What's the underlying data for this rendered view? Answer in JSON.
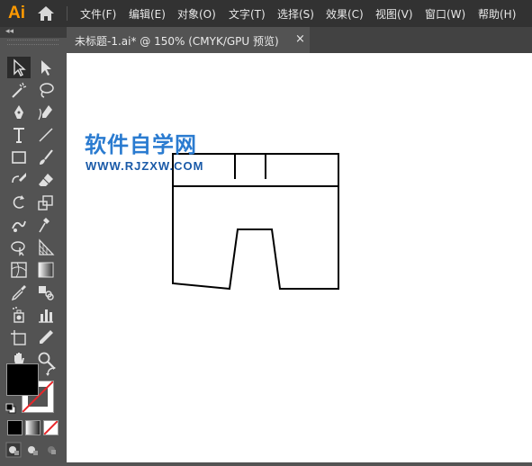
{
  "app": {
    "logo": "Ai"
  },
  "menu": [
    {
      "id": "file",
      "label": "文件(F)"
    },
    {
      "id": "edit",
      "label": "编辑(E)"
    },
    {
      "id": "object",
      "label": "对象(O)"
    },
    {
      "id": "type",
      "label": "文字(T)"
    },
    {
      "id": "select",
      "label": "选择(S)"
    },
    {
      "id": "effect",
      "label": "效果(C)"
    },
    {
      "id": "view",
      "label": "视图(V)"
    },
    {
      "id": "window",
      "label": "窗口(W)"
    },
    {
      "id": "help",
      "label": "帮助(H)"
    }
  ],
  "document_tab": {
    "label": "未标题-1.ai* @ 150% (CMYK/GPU 预览)",
    "close": "×"
  },
  "toolpanel": {
    "collapse": "◂◂"
  },
  "watermark": {
    "title": "软件自学网",
    "url": "WWW.RJZXW.COM"
  },
  "icons": [
    "home-icon",
    "selection-tool-icon",
    "direct-selection-tool-icon",
    "magic-wand-icon",
    "lasso-icon",
    "pen-tool-icon",
    "curvature-tool-icon",
    "type-tool-icon",
    "line-tool-icon",
    "rectangle-tool-icon",
    "paintbrush-icon",
    "shaper-tool-icon",
    "eraser-icon",
    "rotate-tool-icon",
    "scale-tool-icon",
    "warp-tool-icon",
    "puppet-warp-icon",
    "shape-builder-icon",
    "perspective-grid-icon",
    "mesh-tool-icon",
    "gradient-tool-icon",
    "eyedropper-icon",
    "blend-tool-icon",
    "symbol-sprayer-icon",
    "column-graph-icon",
    "artboard-tool-icon",
    "slice-tool-icon",
    "hand-tool-icon",
    "zoom-tool-icon"
  ],
  "colors": {
    "menubar": "#323232",
    "panel": "#535353",
    "accent": "#ff9a00",
    "watermark_title": "#2a7bd0",
    "watermark_url": "#1a5aa8"
  }
}
